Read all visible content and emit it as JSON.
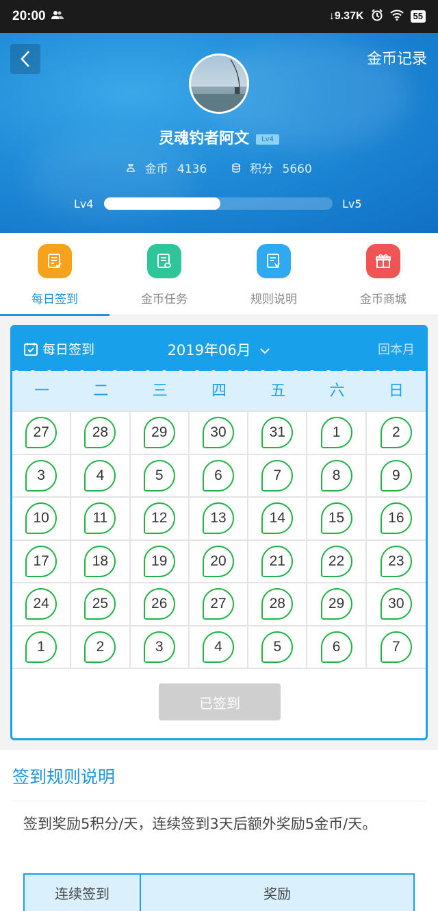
{
  "status_bar": {
    "time": "20:00",
    "speed": "9.37K",
    "battery": "55"
  },
  "header": {
    "coin_record_label": "金币记录",
    "username": "灵魂钓者阿文",
    "level_badge": "Lv4",
    "coins_label": "金币",
    "coins_value": "4136",
    "points_label": "积分",
    "points_value": "5660",
    "level_current": "Lv4",
    "level_next": "Lv5",
    "level_progress": 0.51
  },
  "tabs": [
    {
      "label": "每日签到",
      "icon": "checklist-icon",
      "color": "#f7a21b",
      "active": true
    },
    {
      "label": "金币任务",
      "icon": "coin-task-icon",
      "color": "#2cc69a",
      "active": false
    },
    {
      "label": "规则说明",
      "icon": "rules-icon",
      "color": "#2fa9f1",
      "active": false
    },
    {
      "label": "金币商城",
      "icon": "gift-icon",
      "color": "#f05454",
      "active": false
    }
  ],
  "calendar": {
    "title": "每日签到",
    "month": "2019年06月",
    "back_label": "回本月",
    "weekdays": [
      "一",
      "二",
      "三",
      "四",
      "五",
      "六",
      "日"
    ],
    "days": [
      "27",
      "28",
      "29",
      "30",
      "31",
      "1",
      "2",
      "3",
      "4",
      "5",
      "6",
      "7",
      "8",
      "9",
      "10",
      "11",
      "12",
      "13",
      "14",
      "15",
      "16",
      "17",
      "18",
      "19",
      "20",
      "21",
      "22",
      "23",
      "24",
      "25",
      "26",
      "27",
      "28",
      "29",
      "30",
      "1",
      "2",
      "3",
      "4",
      "5",
      "6",
      "7"
    ],
    "signed_label": "已签到"
  },
  "rules": {
    "title": "签到规则说明",
    "text": "签到奖励5积分/天，连续签到3天后额外奖励5金币/天。",
    "table_header": [
      "连续签到",
      "奖励"
    ]
  }
}
